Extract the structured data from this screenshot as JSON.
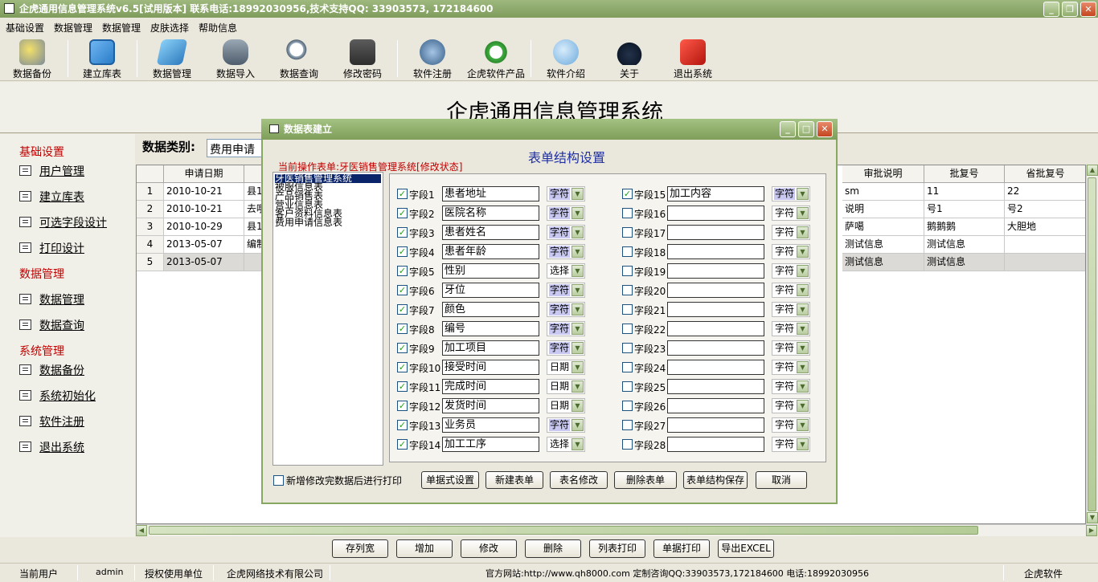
{
  "window": {
    "title": "企虎通用信息管理系统v6.5[试用版本]   联系电话:18992030956,技术支持QQ: 33903573, 172184600"
  },
  "menu": [
    "基础设置",
    "数据管理",
    "数据管理",
    "皮肤选择",
    "帮助信息"
  ],
  "toolbar": [
    {
      "label": "数据备份",
      "icon": "database-backup-icon"
    },
    {
      "label": "建立库表",
      "icon": "create-table-icon"
    },
    {
      "label": "数据管理",
      "icon": "data-manage-icon"
    },
    {
      "label": "数据导入",
      "icon": "data-import-icon"
    },
    {
      "label": "数据查询",
      "icon": "search-icon"
    },
    {
      "label": "修改密码",
      "icon": "key-icon"
    },
    {
      "label": "软件注册",
      "icon": "register-icon"
    },
    {
      "label": "企虎软件产品",
      "icon": "refresh-icon"
    },
    {
      "label": "软件介绍",
      "icon": "chat-icon"
    },
    {
      "label": "关于",
      "icon": "about-icon"
    },
    {
      "label": "退出系统",
      "icon": "exit-icon"
    }
  ],
  "banner": {
    "title": "企虎通用信息管理系统"
  },
  "sidebar": {
    "sections": [
      {
        "title": "基础设置",
        "items": [
          "用户管理",
          "建立库表",
          "可选字段设计",
          "打印设计"
        ]
      },
      {
        "title": "数据管理",
        "items": [
          "数据管理",
          "数据查询"
        ]
      },
      {
        "title": "系统管理",
        "items": [
          "数据备份",
          "系统初始化",
          "软件注册",
          "退出系统"
        ]
      }
    ]
  },
  "category": {
    "label": "数据类别:",
    "value": "费用申请"
  },
  "grid": {
    "left_headers": [
      "",
      "申请日期",
      ""
    ],
    "right_headers": [
      "审批说明",
      "批复号",
      "省批复号"
    ],
    "rows": [
      {
        "num": "1",
        "date": "2010-10-21",
        "c2": "县1",
        "r1": "sm",
        "r2": "11",
        "r3": "22"
      },
      {
        "num": "2",
        "date": "2010-10-21",
        "c2": "去哦",
        "r1": "说明",
        "r2": "号1",
        "r3": "号2"
      },
      {
        "num": "3",
        "date": "2010-10-29",
        "c2": "县1",
        "r1": "萨噶",
        "r2": "鹅鹅鹅",
        "r3": "大胆地"
      },
      {
        "num": "4",
        "date": "2013-05-07",
        "c2": "编制",
        "r1": "测试信息",
        "r2": "测试信息",
        "r3": ""
      },
      {
        "num": "5",
        "date": "2013-05-07",
        "c2": "",
        "r1": "测试信息",
        "r2": "测试信息",
        "r3": ""
      }
    ]
  },
  "bottom_buttons": [
    "存列宽",
    "增加",
    "修改",
    "删除",
    "列表打印",
    "单据打印",
    "导出EXCEL"
  ],
  "status": {
    "user_label": "当前用户",
    "user": "admin",
    "auth_label": "授权使用单位",
    "company": "企虎网络技术有限公司",
    "info": "官方网站:http://www.qh8000.com 定制咨询QQ:33903573,172184600 电话:18992030956",
    "brand": "企虎软件"
  },
  "dialog": {
    "title": "数据表建立",
    "form_title": "表单结构设置",
    "current_op": "当前操作表单:牙医销售管理系统[修改状态]",
    "tables": [
      "牙医销售管理系统",
      "被服信息表",
      "产品销售表",
      "营业信息表",
      "客户资料信息表",
      "费用申请信息表"
    ],
    "fields_left": [
      {
        "label": "字段1",
        "value": "患者地址",
        "type": "字符",
        "checked": "✓"
      },
      {
        "label": "字段2",
        "value": "医院名称",
        "type": "字符",
        "checked": "✓"
      },
      {
        "label": "字段3",
        "value": "患者姓名",
        "type": "字符",
        "checked": "✓"
      },
      {
        "label": "字段4",
        "value": "患者年龄",
        "type": "字符",
        "checked": "✓"
      },
      {
        "label": "字段5",
        "value": "性别",
        "type": "选择",
        "checked": "✓"
      },
      {
        "label": "字段6",
        "value": "牙位",
        "type": "字符",
        "checked": "✓"
      },
      {
        "label": "字段7",
        "value": "颜色",
        "type": "字符",
        "checked": "✓"
      },
      {
        "label": "字段8",
        "value": "编号",
        "type": "字符",
        "checked": "✓"
      },
      {
        "label": "字段9",
        "value": "加工项目",
        "type": "字符",
        "checked": "✓"
      },
      {
        "label": "字段10",
        "value": "接受时间",
        "type": "日期",
        "checked": "✓"
      },
      {
        "label": "字段11",
        "value": "完成时间",
        "type": "日期",
        "checked": "✓"
      },
      {
        "label": "字段12",
        "value": "发货时间",
        "type": "日期",
        "checked": "✓"
      },
      {
        "label": "字段13",
        "value": "业务员",
        "type": "字符",
        "checked": "✓"
      },
      {
        "label": "字段14",
        "value": "加工工序",
        "type": "选择",
        "checked": "✓"
      }
    ],
    "fields_right": [
      {
        "label": "字段15",
        "value": "加工内容",
        "type": "字符",
        "checked": "✓"
      },
      {
        "label": "字段16",
        "value": "",
        "type": "字符",
        "checked": ""
      },
      {
        "label": "字段17",
        "value": "",
        "type": "字符",
        "checked": ""
      },
      {
        "label": "字段18",
        "value": "",
        "type": "字符",
        "checked": ""
      },
      {
        "label": "字段19",
        "value": "",
        "type": "字符",
        "checked": ""
      },
      {
        "label": "字段20",
        "value": "",
        "type": "字符",
        "checked": ""
      },
      {
        "label": "字段21",
        "value": "",
        "type": "字符",
        "checked": ""
      },
      {
        "label": "字段22",
        "value": "",
        "type": "字符",
        "checked": ""
      },
      {
        "label": "字段23",
        "value": "",
        "type": "字符",
        "checked": ""
      },
      {
        "label": "字段24",
        "value": "",
        "type": "字符",
        "checked": ""
      },
      {
        "label": "字段25",
        "value": "",
        "type": "字符",
        "checked": ""
      },
      {
        "label": "字段26",
        "value": "",
        "type": "字符",
        "checked": ""
      },
      {
        "label": "字段27",
        "value": "",
        "type": "字符",
        "checked": ""
      },
      {
        "label": "字段28",
        "value": "",
        "type": "字符",
        "checked": ""
      }
    ],
    "print_option": "新增修改完数据后进行打印",
    "buttons": [
      "单据式设置",
      "新建表单",
      "表名修改",
      "删除表单",
      "表单结构保存",
      "取消"
    ]
  }
}
